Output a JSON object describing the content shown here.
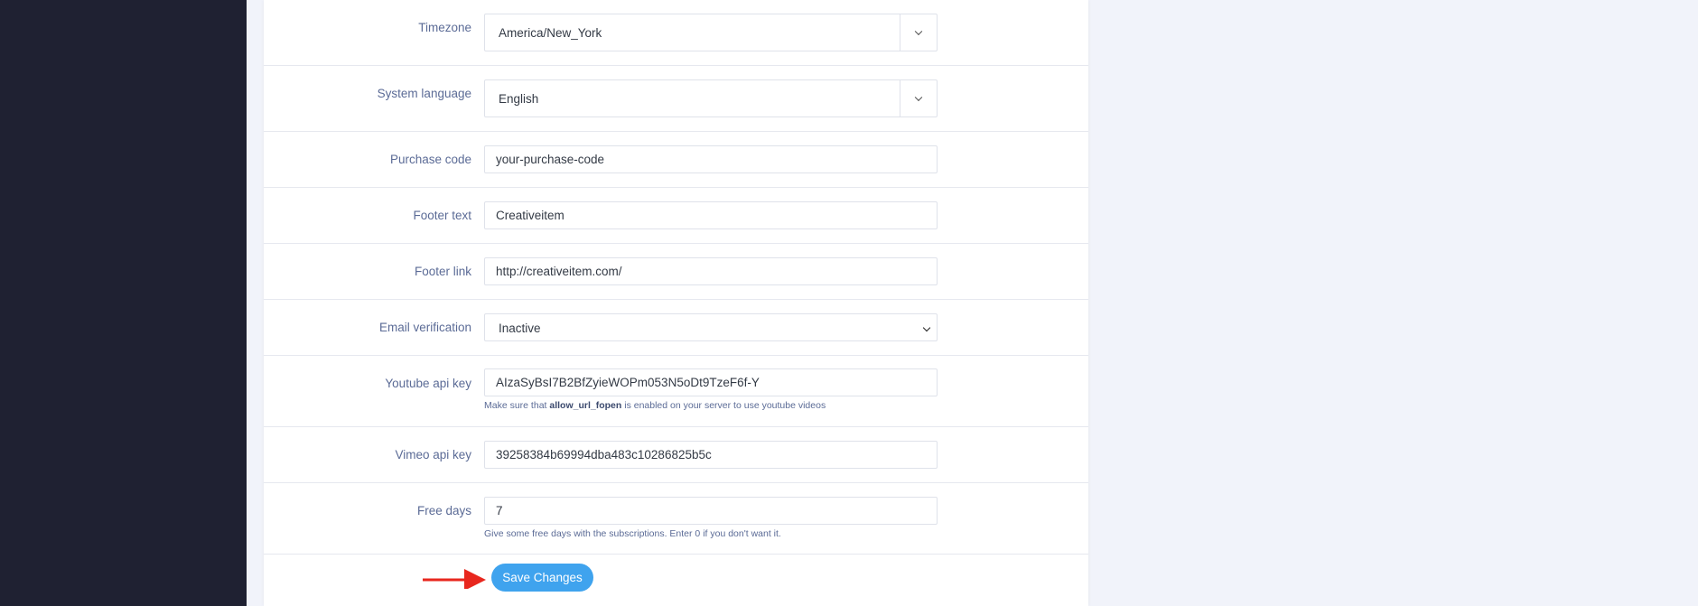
{
  "form": {
    "timezone": {
      "label": "Timezone",
      "value": "America/New_York"
    },
    "system_language": {
      "label": "System language",
      "value": "English"
    },
    "purchase_code": {
      "label": "Purchase code",
      "value": "your-purchase-code"
    },
    "footer_text": {
      "label": "Footer text",
      "value": "Creativeitem"
    },
    "footer_link": {
      "label": "Footer link",
      "value": "http://creativeitem.com/"
    },
    "email_verification": {
      "label": "Email verification",
      "value": "Inactive"
    },
    "youtube_api_key": {
      "label": "Youtube api key",
      "value": "AIzaSyBsI7B2BfZyieWOPm053N5oDt9TzeF6f-Y",
      "help_prefix": "Make sure that",
      "help_bold": "allow_url_fopen",
      "help_suffix": "is enabled on your server to use youtube videos"
    },
    "vimeo_api_key": {
      "label": "Vimeo api key",
      "value": "39258384b69994dba483c10286825b5c"
    },
    "free_days": {
      "label": "Free days",
      "value": "7",
      "help": "Give some free days with the subscriptions. Enter 0 if you don't want it."
    },
    "save_label": "Save Changes"
  },
  "colors": {
    "sidebar": "#1f2132",
    "accent": "#3fa3ee",
    "annotation_arrow": "#e8271e"
  }
}
